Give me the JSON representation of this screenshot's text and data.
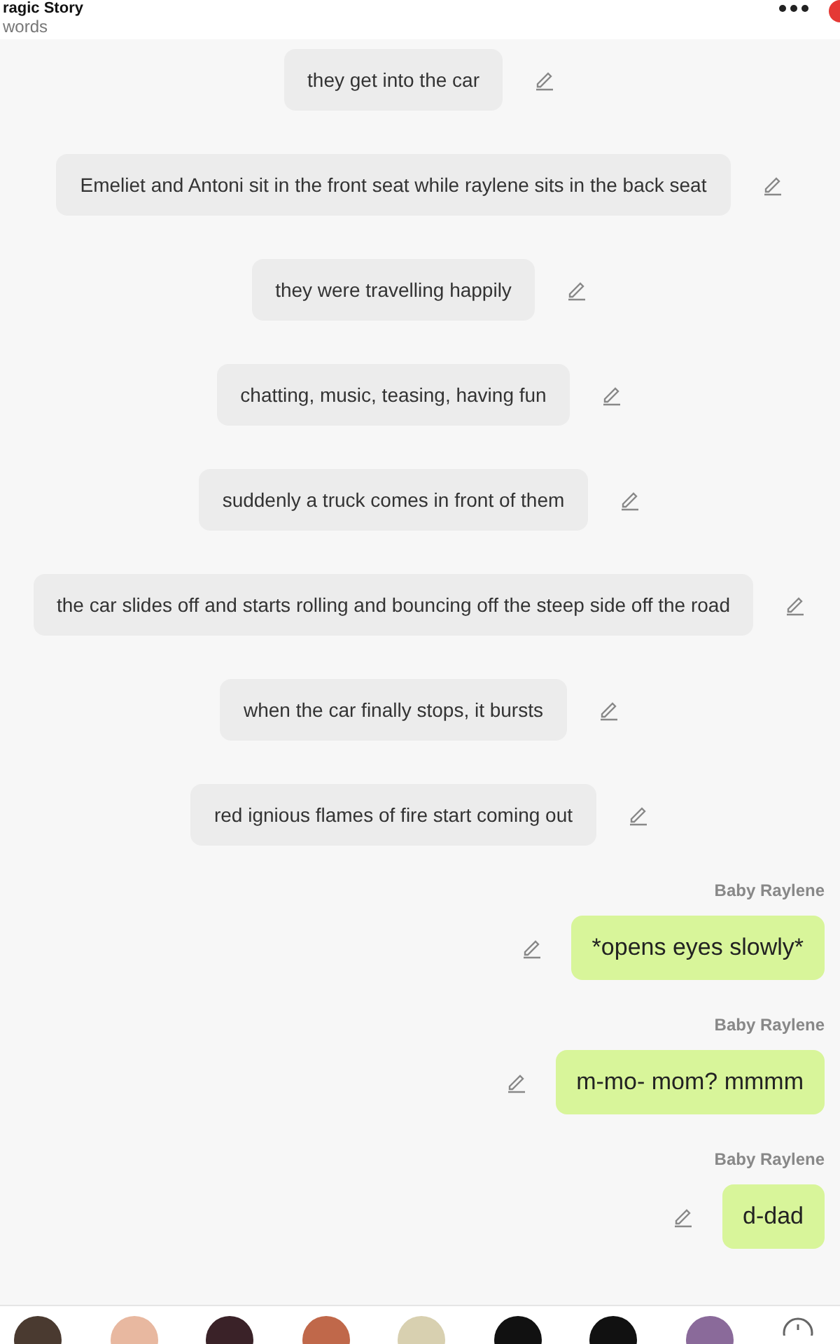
{
  "header": {
    "title": "ragic Story",
    "subtitle": "words"
  },
  "messages": [
    {
      "kind": "narration",
      "text": "they get into the car"
    },
    {
      "kind": "narration",
      "text": "Emeliet and Antoni sit in the front seat while raylene sits in the back seat"
    },
    {
      "kind": "narration",
      "text": "they were travelling happily"
    },
    {
      "kind": "narration",
      "text": "chatting, music, teasing, having fun"
    },
    {
      "kind": "narration",
      "text": "suddenly a truck comes in front of them"
    },
    {
      "kind": "narration",
      "text": "the car slides off and starts rolling and bouncing off the steep side off the road"
    },
    {
      "kind": "narration",
      "text": "when the car finally stops, it bursts"
    },
    {
      "kind": "narration",
      "text": "red ignious flames of fire start coming out"
    },
    {
      "kind": "character",
      "name": "Baby Raylene",
      "text": "*opens eyes slowly*"
    },
    {
      "kind": "character",
      "name": "Baby Raylene",
      "text": "m-mo- mom? mmmm"
    },
    {
      "kind": "character",
      "name": "Baby Raylene",
      "text": "d-dad"
    }
  ],
  "avatars": [
    {
      "color": "#4a3a30"
    },
    {
      "color": "#e8b8a0"
    },
    {
      "color": "#3a2228"
    },
    {
      "color": "#c0684a"
    },
    {
      "color": "#d8d0b0"
    },
    {
      "color": "#111111"
    },
    {
      "color": "#111111"
    },
    {
      "color": "#8a6a9a"
    }
  ]
}
